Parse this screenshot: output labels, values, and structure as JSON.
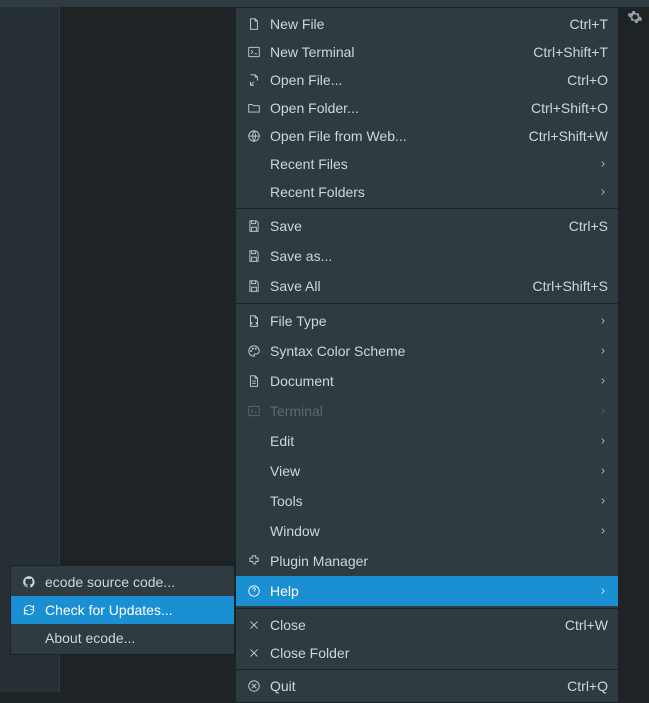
{
  "menu": {
    "groups": [
      [
        {
          "icon": "file",
          "label": "New File",
          "shortcut": "Ctrl+T"
        },
        {
          "icon": "terminal",
          "label": "New Terminal",
          "shortcut": "Ctrl+Shift+T"
        },
        {
          "icon": "open-file",
          "label": "Open File...",
          "shortcut": "Ctrl+O"
        },
        {
          "icon": "folder",
          "label": "Open Folder...",
          "shortcut": "Ctrl+Shift+O"
        },
        {
          "icon": "globe",
          "label": "Open File from Web...",
          "shortcut": "Ctrl+Shift+W"
        },
        {
          "icon": "",
          "label": "Recent Files",
          "submenu": true
        },
        {
          "icon": "",
          "label": "Recent Folders",
          "submenu": true
        }
      ],
      [
        {
          "icon": "save",
          "label": "Save",
          "shortcut": "Ctrl+S"
        },
        {
          "icon": "save",
          "label": "Save as..."
        },
        {
          "icon": "save",
          "label": "Save All",
          "shortcut": "Ctrl+Shift+S"
        }
      ],
      [
        {
          "icon": "filetype",
          "label": "File Type",
          "submenu": true
        },
        {
          "icon": "palette",
          "label": "Syntax Color Scheme",
          "submenu": true
        },
        {
          "icon": "document",
          "label": "Document",
          "submenu": true
        },
        {
          "icon": "terminal-box",
          "label": "Terminal",
          "submenu": true,
          "disabled": true
        },
        {
          "icon": "",
          "label": "Edit",
          "submenu": true
        },
        {
          "icon": "",
          "label": "View",
          "submenu": true
        },
        {
          "icon": "",
          "label": "Tools",
          "submenu": true
        },
        {
          "icon": "",
          "label": "Window",
          "submenu": true
        },
        {
          "icon": "plugin",
          "label": "Plugin Manager"
        },
        {
          "icon": "help",
          "label": "Help",
          "submenu": true,
          "hover": true
        }
      ],
      [
        {
          "icon": "close",
          "label": "Close",
          "shortcut": "Ctrl+W"
        },
        {
          "icon": "close",
          "label": "Close Folder"
        }
      ],
      [
        {
          "icon": "quit",
          "label": "Quit",
          "shortcut": "Ctrl+Q"
        }
      ]
    ]
  },
  "submenu": {
    "items": [
      {
        "icon": "github",
        "label": "ecode source code..."
      },
      {
        "icon": "refresh",
        "label": "Check for Updates...",
        "hover": true
      },
      {
        "icon": "",
        "label": "About ecode..."
      }
    ]
  }
}
